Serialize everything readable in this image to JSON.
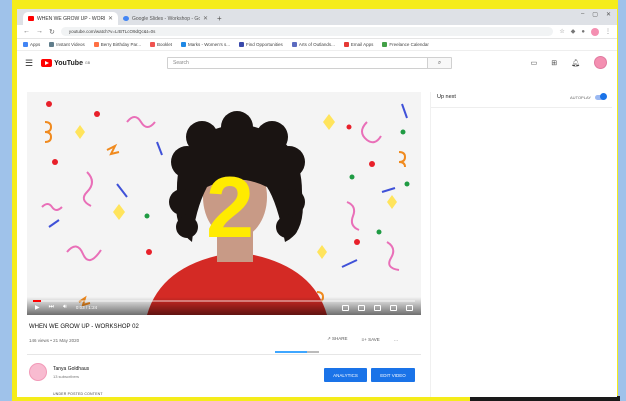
{
  "browser": {
    "tabs": [
      {
        "title": "WHEN WE GROW UP - WORKSH",
        "active": true
      },
      {
        "title": "Google Slides - Workshop - Google ...",
        "active": false
      }
    ],
    "address": "youtube.com/watch?v=LrBTLcO9dQc&t=0s",
    "bookmarks": [
      {
        "label": "Apps",
        "color": "#4285f4"
      },
      {
        "label": "Instant Videos",
        "color": "#607d8b"
      },
      {
        "label": "Berry Birthday Par...",
        "color": "#ff7043"
      },
      {
        "label": "Booklet",
        "color": "#ef5350"
      },
      {
        "label": "Marks - Women's s...",
        "color": "#1e88e5"
      },
      {
        "label": "Find Opportunities",
        "color": "#3949ab"
      },
      {
        "label": "Arts of Outlands...",
        "color": "#5c6bc0"
      },
      {
        "label": "Email Apps",
        "color": "#e53935"
      },
      {
        "label": "Freelance Calendar",
        "color": "#43a047"
      }
    ]
  },
  "youtube": {
    "logo_word": "YouTube",
    "logo_region": "GB",
    "search_placeholder": "Search",
    "up_next": "Up next",
    "autoplay": "AUTOPLAY"
  },
  "video": {
    "overlay_number": "2",
    "progress_fraction": 0.02,
    "time": "0:03 / 1:24",
    "title": "WHEN WE GROW UP - WORKSHOP 02",
    "meta": "146 views • 21 May 2020",
    "like_label": "SHARE",
    "save_label": "SAVE"
  },
  "channel": {
    "name": "Tanya Goldhaus",
    "subs": "13 subscribers",
    "analytics_button": "ANALYTICS",
    "edit_button": "EDIT VIDEO",
    "description": "UNDER POSTED CONTENT"
  },
  "colors": {
    "frame": "#f5ec1a",
    "strip": "#9fc2ea",
    "yt_red": "#ff0000",
    "button_blue": "#1a73e8",
    "overlay_yellow": "#ffeb00"
  }
}
